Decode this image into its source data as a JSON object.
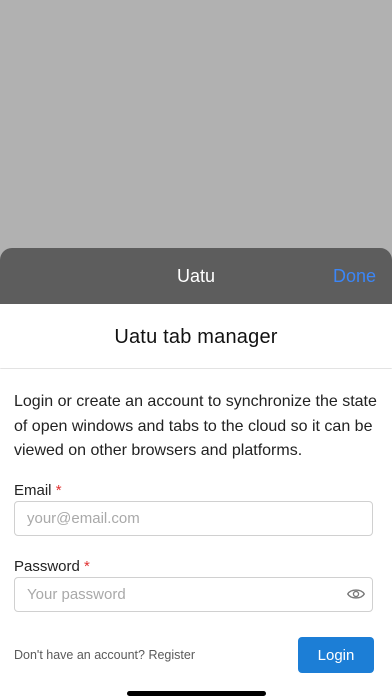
{
  "sheet": {
    "title": "Uatu",
    "done_label": "Done"
  },
  "main": {
    "app_title": "Uatu tab manager",
    "description": "Login or create an account to synchronize the state of open windows and tabs to the cloud so it can be viewed on other browsers and platforms.",
    "email": {
      "label": "Email",
      "required_mark": "*",
      "placeholder": "your@email.com",
      "value": ""
    },
    "password": {
      "label": "Password",
      "required_mark": "*",
      "placeholder": "Your password",
      "value": "",
      "toggle_icon": "eye-icon"
    },
    "register_prompt": "Don't have an account?",
    "register_link": "Register",
    "login_label": "Login"
  },
  "colors": {
    "accent": "#3b86f7",
    "login_button": "#1c7ed6",
    "header_bg": "#5d5d5d",
    "backdrop": "#b1b1b1",
    "required": "#e03131"
  }
}
